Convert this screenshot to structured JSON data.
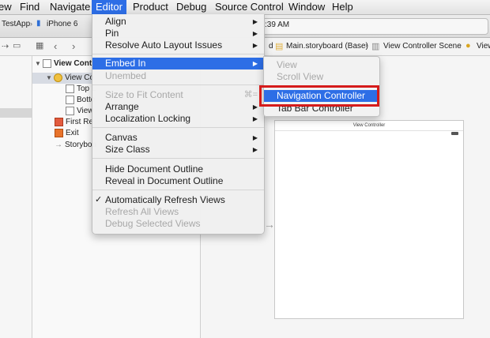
{
  "menubar": {
    "items": [
      "ew",
      "Find",
      "Navigate",
      "Editor",
      "Product",
      "Debug",
      "Source Control",
      "Window",
      "Help"
    ]
  },
  "toolbar": {
    "scheme_app": "TestApp",
    "scheme_device": "iPhone 6",
    "activity_text": ":39 AM"
  },
  "jumpbar": {
    "crumbs": [
      "d",
      "Main.storyboard (Base)",
      "View Controller Scene",
      "View"
    ]
  },
  "outline": {
    "rows": [
      "View Cont",
      "View Co",
      "Top L",
      "Botto",
      "View",
      "First Re",
      "Exit",
      "Storyboa"
    ]
  },
  "canvas": {
    "scene_title": "View Controller"
  },
  "editor_menu": {
    "items": [
      {
        "label": "Align",
        "submenu": true,
        "disabled": false
      },
      {
        "label": "Pin",
        "submenu": true,
        "disabled": false
      },
      {
        "label": "Resolve Auto Layout Issues",
        "submenu": true,
        "disabled": false
      },
      {
        "label": "Embed In",
        "submenu": true,
        "disabled": false,
        "highlighted": true
      },
      {
        "label": "Unembed",
        "submenu": false,
        "disabled": true
      },
      {
        "label": "Size to Fit Content",
        "shortcut": "⌘=",
        "disabled": true
      },
      {
        "label": "Arrange",
        "submenu": true,
        "disabled": false
      },
      {
        "label": "Localization Locking",
        "submenu": true,
        "disabled": false
      },
      {
        "label": "Canvas",
        "submenu": true,
        "disabled": false
      },
      {
        "label": "Size Class",
        "submenu": true,
        "disabled": false
      },
      {
        "label": "Hide Document Outline",
        "disabled": false
      },
      {
        "label": "Reveal in Document Outline",
        "disabled": false
      },
      {
        "label": "Automatically Refresh Views",
        "checked": true,
        "disabled": false
      },
      {
        "label": "Refresh All Views",
        "disabled": true
      },
      {
        "label": "Debug Selected Views",
        "disabled": true
      }
    ]
  },
  "embed_submenu": {
    "items": [
      {
        "label": "View",
        "disabled": true
      },
      {
        "label": "Scroll View",
        "disabled": true
      },
      {
        "label": "Navigation Controller",
        "disabled": false,
        "highlighted": true
      },
      {
        "label": "Tab Bar Controller",
        "disabled": false
      }
    ]
  },
  "colors": {
    "highlight": "#2d6ee6",
    "callout_red": "#d51b1b"
  }
}
